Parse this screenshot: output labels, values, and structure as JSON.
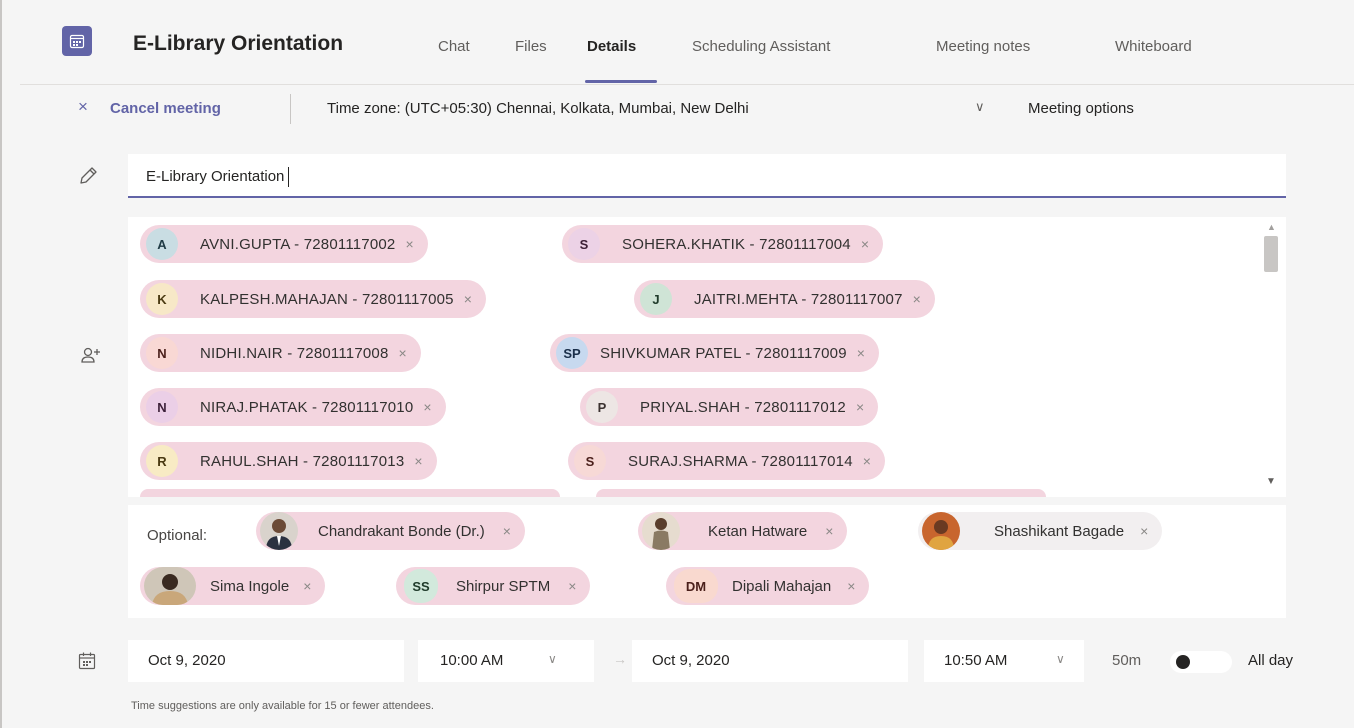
{
  "header": {
    "title": "E-Library Orientation",
    "tabs": [
      {
        "label": "Chat"
      },
      {
        "label": "Files"
      },
      {
        "label": "Details"
      },
      {
        "label": "Scheduling Assistant"
      },
      {
        "label": "Meeting notes"
      },
      {
        "label": "Whiteboard"
      }
    ],
    "active_tab": "Details",
    "accent_color": "#6264a7"
  },
  "toolbar": {
    "cancel_icon": "×",
    "cancel_label": "Cancel meeting",
    "timezone_label": "Time zone: (UTC+05:30) Chennai, Kolkata, Mumbai, New Delhi",
    "timezone_chevron": "∨",
    "meeting_options_label": "Meeting options"
  },
  "meeting_title": {
    "value": "E-Library Orientation"
  },
  "required_attendees": [
    {
      "initials": "A",
      "name": "AVNI.GUPTA - 72801117002",
      "avatar_bg": "#c9dde3",
      "avatar_fg": "#1f3b45"
    },
    {
      "initials": "S",
      "name": "SOHERA.KHATIK - 72801117004",
      "avatar_bg": "#ecd2e6",
      "avatar_fg": "#3b1f35"
    },
    {
      "initials": "K",
      "name": "KALPESH.MAHAJAN - 72801117005",
      "avatar_bg": "#f7e8c7",
      "avatar_fg": "#4a3a12"
    },
    {
      "initials": "J",
      "name": "JAITRI.MEHTA - 72801117007",
      "avatar_bg": "#cfe4d6",
      "avatar_fg": "#1f3b2a"
    },
    {
      "initials": "N",
      "name": "NIDHI.NAIR - 72801117008",
      "avatar_bg": "#f9d8d4",
      "avatar_fg": "#4a1f1a"
    },
    {
      "initials": "SP",
      "name": "SHIVKUMAR PATEL - 72801117009",
      "avatar_bg": "#c7d9ef",
      "avatar_fg": "#1a2f4a"
    },
    {
      "initials": "N",
      "name": "NIRAJ.PHATAK - 72801117010",
      "avatar_bg": "#ebcfe7",
      "avatar_fg": "#3b1f38"
    },
    {
      "initials": "P",
      "name": "PRIYAL.SHAH - 72801117012",
      "avatar_bg": "#ede6e4",
      "avatar_fg": "#3b3230"
    },
    {
      "initials": "R",
      "name": "RAHUL.SHAH - 72801117013",
      "avatar_bg": "#f8ebc4",
      "avatar_fg": "#4a3a12"
    },
    {
      "initials": "S",
      "name": "SURAJ.SHARMA - 72801117014",
      "avatar_bg": "#f7d9d6",
      "avatar_fg": "#4a1f1a"
    }
  ],
  "optional_attendees": {
    "label": "Optional:",
    "people": [
      {
        "name": "Chandrakant Bonde (Dr.)",
        "avatar": "photo"
      },
      {
        "name": "Ketan Hatware",
        "avatar": "photo"
      },
      {
        "name": "Shashikant Bagade",
        "avatar": "photo"
      },
      {
        "name": "Sima Ingole",
        "avatar": "photo"
      },
      {
        "name": "Shirpur SPTM",
        "initials": "SS",
        "avatar_bg": "#d2e9dc"
      },
      {
        "name": "Dipali Mahajan",
        "initials": "DM",
        "avatar_bg": "#f9d9cf"
      }
    ]
  },
  "schedule": {
    "start_date": "Oct 9, 2020",
    "start_time": "10:00 AM",
    "end_date": "Oct 9, 2020",
    "end_time": "10:50 AM",
    "duration": "50m",
    "all_day_label": "All day",
    "all_day": false,
    "chevron": "∨",
    "arrow": "→",
    "hint": "Time suggestions are only available for 15 or fewer attendees."
  },
  "icons": {
    "chip_remove": "×",
    "scroll_up": "▲",
    "scroll_down": "▼"
  }
}
